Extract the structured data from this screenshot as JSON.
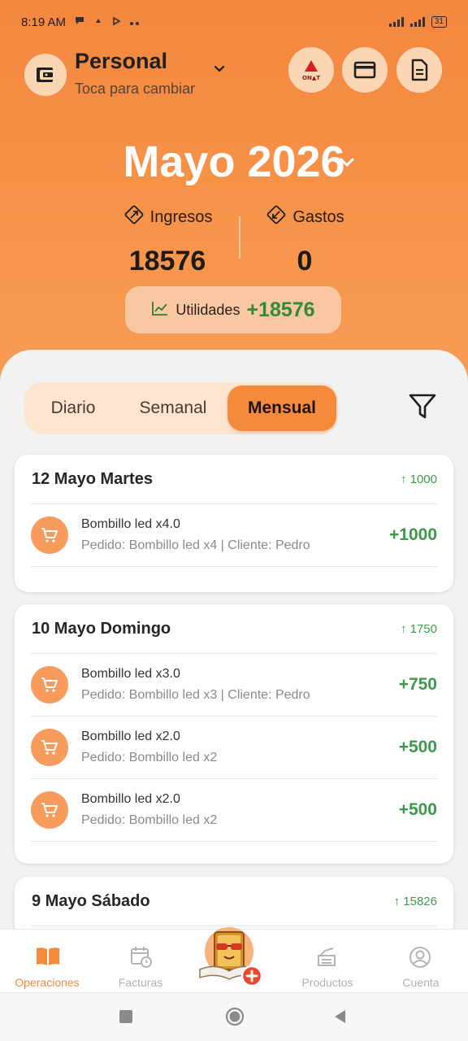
{
  "status": {
    "time": "8:19 AM",
    "battery": "31"
  },
  "account": {
    "name": "Personal",
    "subtitle": "Toca para cambiar"
  },
  "header_buttons": [
    "onat-logo-button",
    "card-button",
    "document-button"
  ],
  "onat_logo_text": "ON▲T",
  "period": {
    "label": "Mayo 2026"
  },
  "summary": {
    "income_label": "Ingresos",
    "income_value": "18576",
    "expense_label": "Gastos",
    "expense_value": "0",
    "profit_label": "Utilidades",
    "profit_value": "+18576"
  },
  "tabs": [
    {
      "label": "Diario",
      "active": false
    },
    {
      "label": "Semanal",
      "active": false
    },
    {
      "label": "Mensual",
      "active": true
    }
  ],
  "days": [
    {
      "date": "12 Mayo Martes",
      "total": "1000",
      "transactions": [
        {
          "title": "Bombillo led x4.0",
          "subtitle": "Pedido: Bombillo led x4 | Cliente: Pedro",
          "amount": "+1000"
        }
      ]
    },
    {
      "date": "10 Mayo Domingo",
      "total": "1750",
      "transactions": [
        {
          "title": "Bombillo led x3.0",
          "subtitle": "Pedido: Bombillo led x3 | Cliente: Pedro",
          "amount": "+750"
        },
        {
          "title": "Bombillo led x2.0",
          "subtitle": "Pedido: Bombillo led x2",
          "amount": "+500"
        },
        {
          "title": "Bombillo led x2.0",
          "subtitle": "Pedido: Bombillo led x2",
          "amount": "+500"
        }
      ]
    },
    {
      "date": "9 Mayo Sábado",
      "total": "15826",
      "transactions": []
    }
  ],
  "nav": [
    {
      "label": "Operaciones",
      "active": true
    },
    {
      "label": "Facturas",
      "active": false
    },
    {
      "label": "Productos",
      "active": false
    },
    {
      "label": "Cuenta",
      "active": false
    }
  ],
  "colors": {
    "accent": "#f58a3c",
    "positive": "#3d9a4a",
    "header": "#f6934a"
  }
}
